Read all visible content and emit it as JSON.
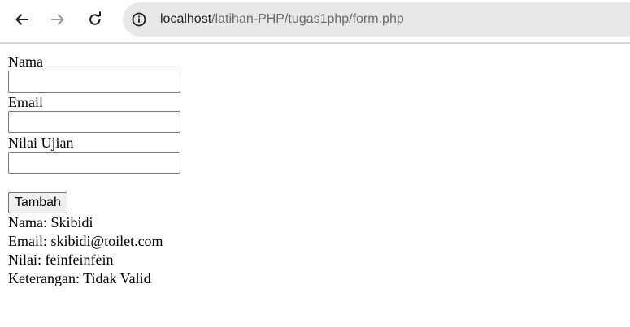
{
  "browser": {
    "url_host": "localhost",
    "url_path": "/latihan-PHP/tugas1php/form.php",
    "back_icon": "arrow-left",
    "forward_icon": "arrow-right",
    "reload_icon": "reload",
    "site_info_icon": "info-circle"
  },
  "form": {
    "nama_label": "Nama",
    "nama_value": "",
    "email_label": "Email",
    "email_value": "",
    "nilai_label": "Nilai Ujian",
    "nilai_value": "",
    "submit_label": "Tambah"
  },
  "result": {
    "nama": "Nama: Skibidi",
    "email": "Email: skibidi@toilet.com",
    "nilai": "Nilai: feinfeinfein",
    "keterangan": "Keterangan: Tidak Valid"
  },
  "colors": {
    "toolbar_bg": "#ffffff",
    "omnibox_bg": "#e8e8e8",
    "url_path_color": "#6b6b6b",
    "url_host_color": "#1f1f1f"
  }
}
